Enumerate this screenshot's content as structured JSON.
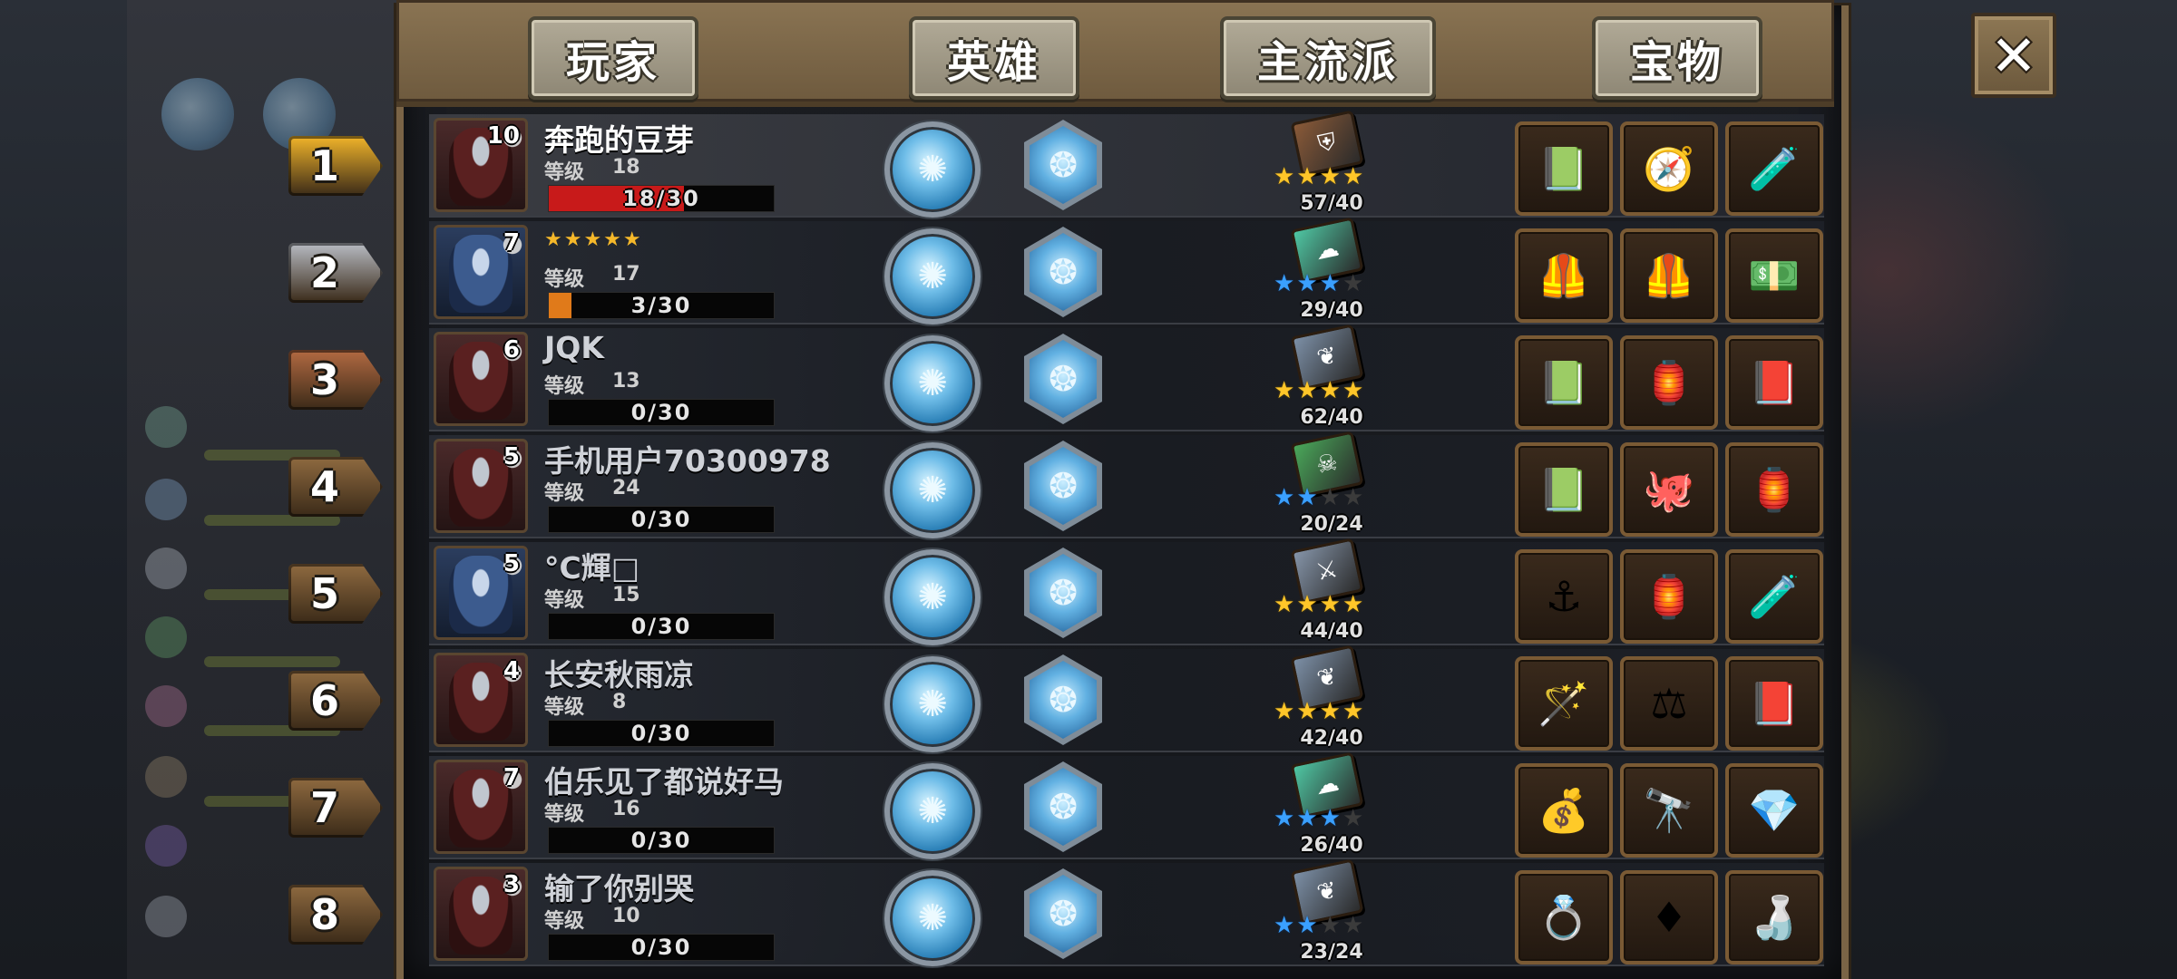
{
  "tabs": [
    {
      "label": "玩家"
    },
    {
      "label": "英雄"
    },
    {
      "label": "主流派"
    },
    {
      "label": "宝物"
    }
  ],
  "close_label": "✕",
  "level_label": "等级",
  "players": [
    {
      "rank": "1",
      "name": "奔跑的豆芽",
      "avatar_level": "10",
      "avatar_style": "red",
      "level": "18",
      "xp": "18/30",
      "xp_fraction": 0.6,
      "xp_color": "#c81a1a",
      "stars_on": 4,
      "stars_total": 4,
      "star_color": "gold",
      "book_color": "#8a5a38",
      "book_icon": "shield-book-icon",
      "progress": "57/40",
      "treasures": [
        "green-book-icon",
        "compass-icon",
        "potion-icon"
      ]
    },
    {
      "rank": "2",
      "name": "★★★★★",
      "avatar_level": "7",
      "avatar_style": "blue",
      "level": "17",
      "xp": "3/30",
      "xp_fraction": 0.1,
      "xp_color": "#e07a1a",
      "stars_on": 3,
      "stars_total": 4,
      "star_color": "blue",
      "book_color": "#4fc7a3",
      "book_icon": "cloud-book-icon",
      "progress": "29/40",
      "treasures": [
        "leather-armor-icon",
        "leather-armor-icon",
        "cash-pile-icon"
      ]
    },
    {
      "rank": "3",
      "name": "JQK",
      "avatar_level": "6",
      "avatar_style": "red",
      "level": "13",
      "xp": "0/30",
      "xp_fraction": 0,
      "xp_color": "#c81a1a",
      "stars_on": 4,
      "stars_total": 4,
      "star_color": "gold",
      "book_color": "#7c8fa6",
      "book_icon": "wing-book-icon",
      "progress": "62/40",
      "treasures": [
        "green-book-icon",
        "lantern-icon",
        "magic-tome-icon"
      ]
    },
    {
      "rank": "4",
      "name": "手机用户70300978",
      "avatar_level": "5",
      "avatar_style": "red",
      "level": "24",
      "xp": "0/30",
      "xp_fraction": 0,
      "xp_color": "#c81a1a",
      "stars_on": 2,
      "stars_total": 4,
      "star_color": "blue",
      "book_color": "#4aa85a",
      "book_icon": "skull-book-icon",
      "progress": "20/24",
      "treasures": [
        "green-book-icon",
        "kraken-idol-icon",
        "lantern-icon"
      ]
    },
    {
      "rank": "5",
      "name": "°C輝□",
      "avatar_level": "5",
      "avatar_style": "blue",
      "level": "15",
      "xp": "0/30",
      "xp_fraction": 0,
      "xp_color": "#c81a1a",
      "stars_on": 4,
      "stars_total": 4,
      "star_color": "gold",
      "book_color": "#8594a8",
      "book_icon": "sword-book-icon",
      "progress": "44/40",
      "treasures": [
        "anchor-icon",
        "lantern-icon",
        "potion-icon"
      ]
    },
    {
      "rank": "6",
      "name": "长安秋雨凉",
      "avatar_level": "4",
      "avatar_style": "red",
      "level": "8",
      "xp": "0/30",
      "xp_fraction": 0,
      "xp_color": "#c81a1a",
      "stars_on": 4,
      "stars_total": 4,
      "star_color": "gold",
      "book_color": "#7c8fa6",
      "book_icon": "wing-book-icon",
      "progress": "42/40",
      "treasures": [
        "staff-icon",
        "scales-icon",
        "magic-tome-icon"
      ]
    },
    {
      "rank": "7",
      "name": "伯乐见了都说好马",
      "avatar_level": "7",
      "avatar_style": "red",
      "level": "16",
      "xp": "0/30",
      "xp_fraction": 0,
      "xp_color": "#c81a1a",
      "stars_on": 3,
      "stars_total": 4,
      "star_color": "blue",
      "book_color": "#4fc7a3",
      "book_icon": "cloud-book-icon",
      "progress": "26/40",
      "treasures": [
        "treasure-sack-icon",
        "telescope-icon",
        "emerald-cube-icon"
      ]
    },
    {
      "rank": "8",
      "name": "输了你别哭",
      "avatar_level": "3",
      "avatar_style": "red",
      "level": "10",
      "xp": "0/30",
      "xp_fraction": 0,
      "xp_color": "#c81a1a",
      "stars_on": 2,
      "stars_total": 4,
      "star_color": "blue",
      "book_color": "#7c8fa6",
      "book_icon": "wing-book-icon",
      "progress": "23/24",
      "treasures": [
        "bracelet-icon",
        "ruby-icon",
        "green-potion-icon"
      ]
    }
  ],
  "rank_colors": [
    "#f2b52a",
    "#b8bcc4",
    "#b36a42",
    "#8f6a40",
    "#8f6a40",
    "#8f6a40",
    "#8f6a40",
    "#8f6a40"
  ]
}
